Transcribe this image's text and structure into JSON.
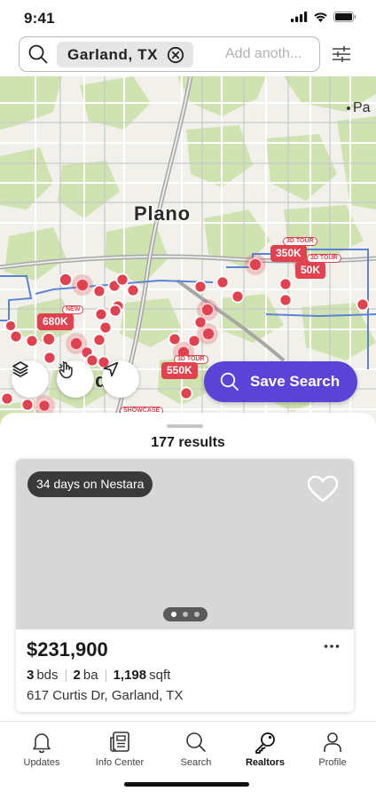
{
  "status_bar": {
    "time": "9:41"
  },
  "search": {
    "chip_label": "Garland, TX",
    "placeholder": "Add anoth..."
  },
  "map": {
    "city_label": "Plano",
    "edge_label": "Pa",
    "partial_label": "G",
    "partial_label_tail": "d",
    "price_pins": [
      {
        "label": "680K",
        "tag": "NEW"
      },
      {
        "label": "350K",
        "tag": "3D TOUR"
      },
      {
        "label": "50K",
        "tag": "3D TOUR"
      },
      {
        "label": "550K",
        "tag": "3D TOUR"
      }
    ],
    "showcase_tag": "SHOWCASE",
    "save_search_label": "Save Search"
  },
  "results": {
    "count_label": "177 results"
  },
  "listing": {
    "days_on_market": "34 days on Nestara",
    "price": "$231,900",
    "beds_value": "3",
    "beds_unit": "bds",
    "baths_value": "2",
    "baths_unit": "ba",
    "sqft_value": "1,198",
    "sqft_unit": "sqft",
    "address": "617 Curtis Dr, Garland, TX",
    "photo_count": 3,
    "active_photo": 1
  },
  "tabs": [
    {
      "label": "Updates",
      "icon": "bell-icon"
    },
    {
      "label": "Info Center",
      "icon": "newspaper-icon"
    },
    {
      "label": "Search",
      "icon": "search-icon"
    },
    {
      "label": "Realtors",
      "icon": "key-icon",
      "active": true
    },
    {
      "label": "Profile",
      "icon": "person-icon"
    }
  ],
  "colors": {
    "accent": "#5a43d6",
    "pin": "#e0434f",
    "map_green": "#cfe3b0",
    "map_border": "#5b84d6"
  }
}
